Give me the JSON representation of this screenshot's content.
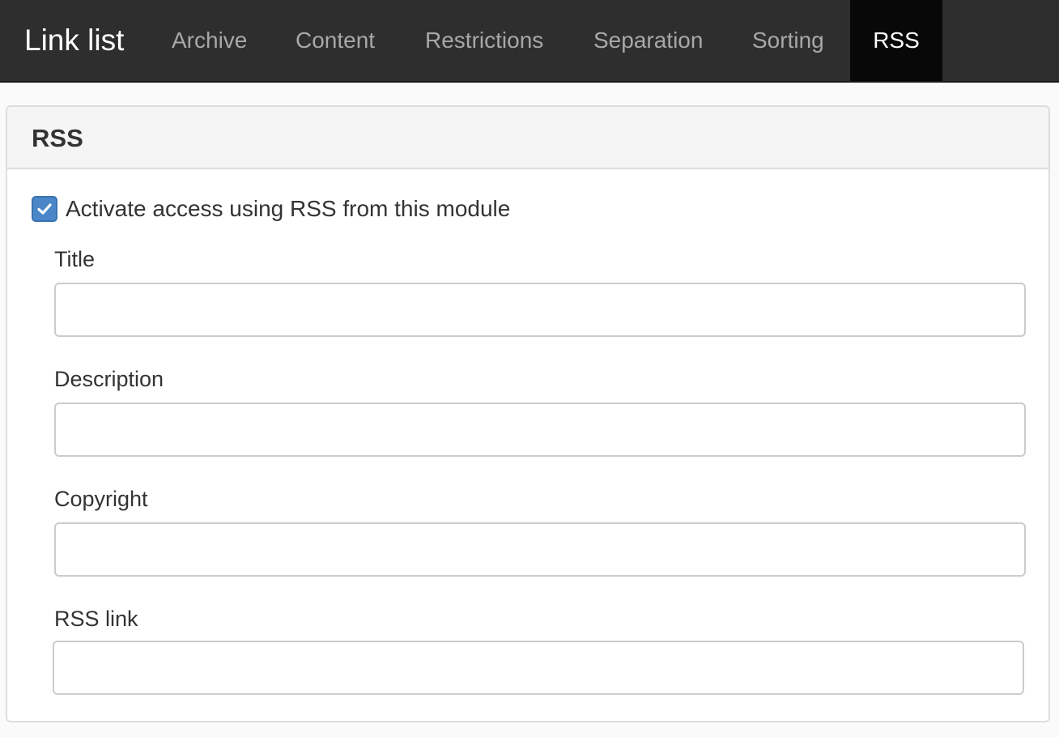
{
  "navbar": {
    "brand": "Link list",
    "items": [
      {
        "label": "Archive"
      },
      {
        "label": "Content"
      },
      {
        "label": "Restrictions"
      },
      {
        "label": "Separation"
      },
      {
        "label": "Sorting"
      },
      {
        "label": "RSS",
        "active": true
      }
    ]
  },
  "panel": {
    "title": "RSS",
    "activate": {
      "label": "Activate access using RSS from this module",
      "checked": true
    },
    "fields": [
      {
        "label": "Title",
        "value": "",
        "placeholder": ""
      },
      {
        "label": "Description",
        "value": "",
        "placeholder": ""
      },
      {
        "label": "Copyright",
        "value": "",
        "placeholder": ""
      },
      {
        "label": "RSS link",
        "value": "",
        "placeholder": ""
      }
    ]
  },
  "colors": {
    "navbar_bg": "#2e2e2e",
    "nav_active_bg": "#080808",
    "checkbox_accent": "#4a86c8"
  },
  "icons": {
    "checkbox": "checkmark-icon"
  }
}
